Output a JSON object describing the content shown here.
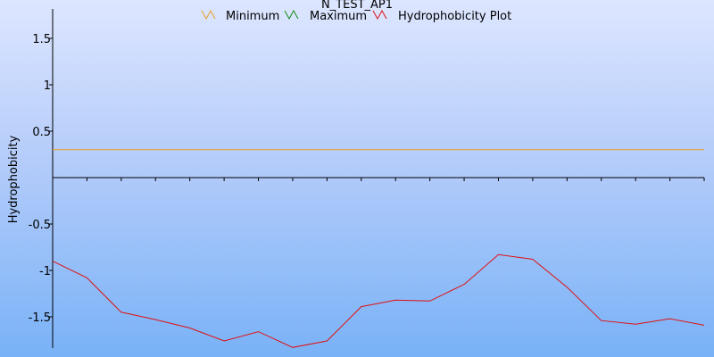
{
  "chart_data": {
    "type": "line",
    "title": "N_TEST_AP1",
    "xlabel": "",
    "ylabel": "Hydrophobicity",
    "ylim": [
      -1.8,
      1.8
    ],
    "yticks": [
      1.5,
      1,
      0.5,
      -0.5,
      -1,
      -1.5
    ],
    "ytick_labels": [
      "1.5",
      "1",
      "0.5",
      "-0.5",
      "-1",
      "-1.5"
    ],
    "x": [
      1,
      2,
      3,
      4,
      5,
      6,
      7,
      8,
      9,
      10,
      11,
      12,
      13,
      14,
      15,
      16,
      17,
      18,
      19,
      20
    ],
    "xlim": [
      1,
      20
    ],
    "series": [
      {
        "name": "Minimum",
        "color": "#e8a020",
        "values": []
      },
      {
        "name": "Maximum",
        "color": "#108a10",
        "values": []
      },
      {
        "name": "Hydrophobicity Plot",
        "color": "#e01010",
        "values": [
          -0.9,
          -1.08,
          -1.45,
          -1.53,
          -1.62,
          -1.76,
          -1.66,
          -1.83,
          -1.76,
          -1.39,
          -1.32,
          -1.33,
          -1.15,
          -0.83,
          -0.88,
          -1.18,
          -1.54,
          -1.58,
          -1.52,
          -1.59
        ]
      }
    ],
    "threshold": {
      "value": 0.3,
      "color": "#e8a020"
    },
    "legend_position": "top-center",
    "grid": false
  }
}
